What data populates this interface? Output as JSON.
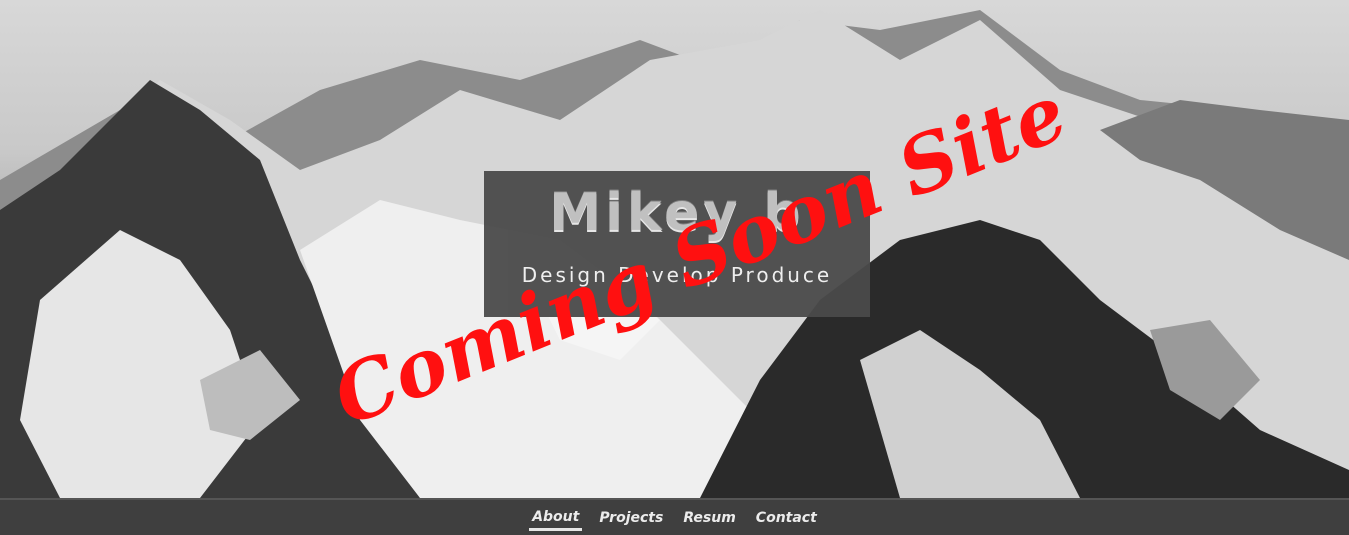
{
  "hero": {
    "brand_name": "Mikey b",
    "tagline": "Design Develop Produce",
    "overlay_text": "Coming Soon Site"
  },
  "nav": {
    "items": [
      {
        "label": "About",
        "active": true
      },
      {
        "label": "Projects",
        "active": false
      },
      {
        "label": "Resum",
        "active": false
      },
      {
        "label": "Contact",
        "active": false
      }
    ]
  },
  "colors": {
    "overlay_text": "#ff1010",
    "brand_box": "#4a4a4a",
    "navbar": "#3f3f3f"
  }
}
